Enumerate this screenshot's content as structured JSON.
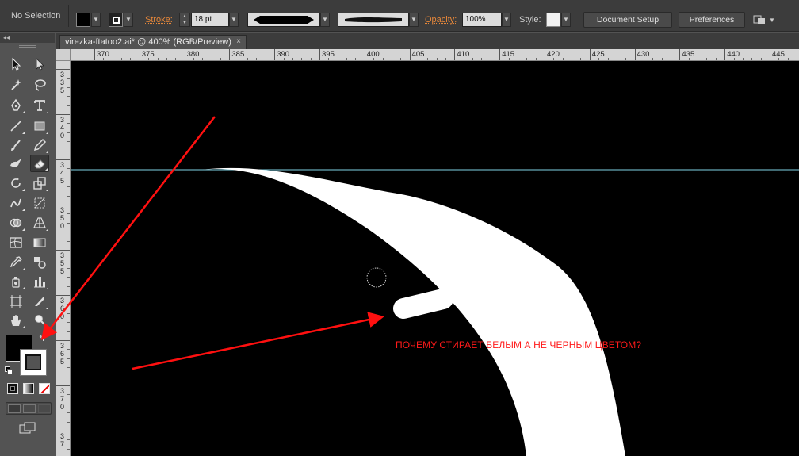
{
  "control_bar": {
    "selection_label": "No Selection",
    "stroke_label": "Stroke:",
    "stroke_weight": "18 pt",
    "opacity_label": "Opacity:",
    "opacity_value": "100%",
    "style_label": "Style:",
    "document_setup_label": "Document Setup",
    "preferences_label": "Preferences",
    "fill_color": "#000000"
  },
  "document": {
    "tab_title": "virezka-ftatoo2.ai* @ 400% (RGB/Preview)",
    "close_glyph": "×",
    "background_color": "#000000",
    "guide_color": "#7fd3e6"
  },
  "ruler": {
    "h_ticks": [
      "370",
      "375",
      "380",
      "385",
      "390",
      "395",
      "400",
      "405",
      "410",
      "415",
      "420",
      "425",
      "430",
      "435",
      "440",
      "445"
    ],
    "v_labels": [
      "3\n3\n5",
      "3\n4\n0",
      "3\n4\n5",
      "3\n5\n0",
      "3\n5\n5",
      "3\n6\n0",
      "3\n6\n5",
      "3\n7\n0",
      "3\n7"
    ]
  },
  "tools": {
    "panel_collapse": "◂◂",
    "active_tool": "eraser-tool"
  },
  "annotation": {
    "question": "ПОЧЕМУ СТИРАЕТ БЕЛЫМ А НЕ ЧЕРНЫМ ЦВЕТОМ?",
    "arrow_color": "#ff1010"
  }
}
